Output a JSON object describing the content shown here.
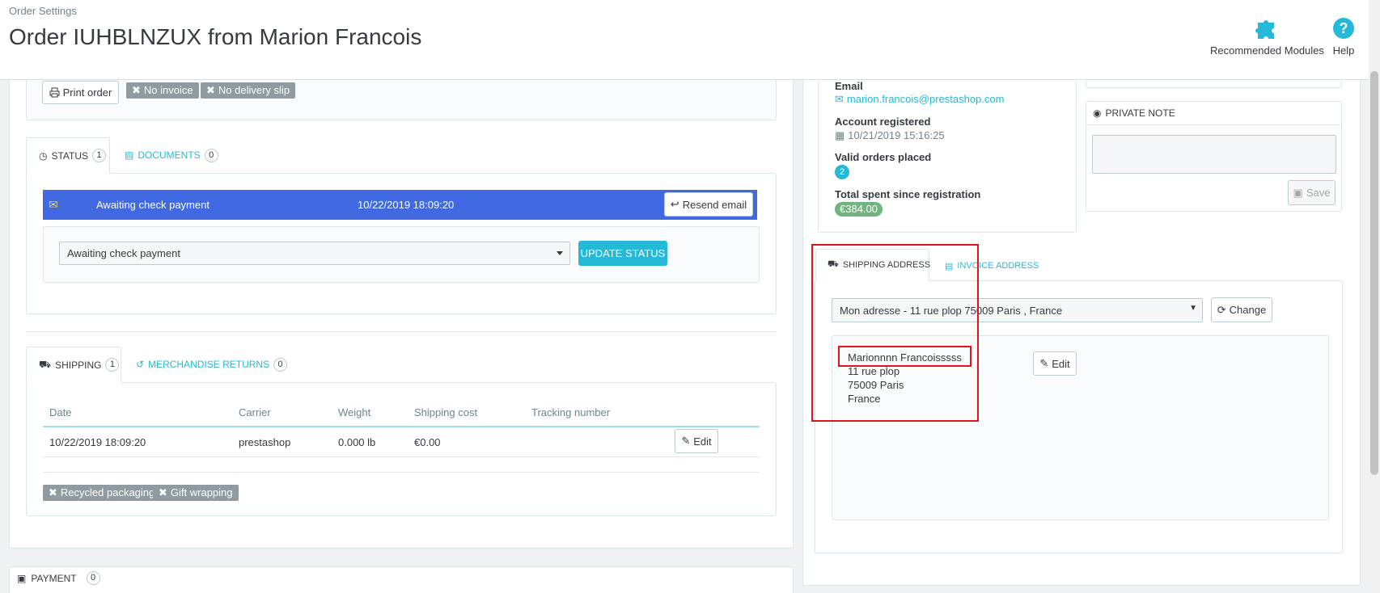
{
  "header": {
    "breadcrumb": "Order Settings",
    "title": "Order IUHBLNZUX from Marion Francois",
    "tools": [
      {
        "label": "Recommended Modules",
        "icon": "puzzle-icon"
      },
      {
        "label": "Help",
        "icon": "help-icon"
      }
    ]
  },
  "order_actions": {
    "print_label": "Print order",
    "no_invoice": "No invoice",
    "no_delivery_slip": "No delivery slip"
  },
  "status_panel": {
    "tabs": [
      {
        "label": "STATUS",
        "count": "1"
      },
      {
        "label": "DOCUMENTS",
        "count": "0"
      }
    ],
    "current": {
      "status": "Awaiting check payment",
      "date": "10/22/2019 18:09:20",
      "resend_label": "Resend email",
      "color": "#4169e1"
    },
    "select_value": "Awaiting check payment",
    "update_label": "UPDATE STATUS"
  },
  "shipping_panel": {
    "tabs": [
      {
        "label": "SHIPPING",
        "count": "1"
      },
      {
        "label": "MERCHANDISE RETURNS",
        "count": "0"
      }
    ],
    "columns": [
      "Date",
      "Carrier",
      "Weight",
      "Shipping cost",
      "Tracking number"
    ],
    "rows": [
      {
        "date": "10/22/2019 18:09:20",
        "carrier": "prestashop",
        "weight": "0.000 lb",
        "cost": "€0.00",
        "tracking": "",
        "edit_label": "Edit"
      }
    ],
    "tags": [
      "Recycled packaging",
      "Gift wrapping"
    ]
  },
  "payment": {
    "label": "PAYMENT",
    "count": "0"
  },
  "customer": {
    "email_label": "Email",
    "email": "marion.francois@prestashop.com",
    "registered_label": "Account registered",
    "registered": "10/21/2019 15:16:25",
    "orders_label": "Valid orders placed",
    "orders": "2",
    "spent_label": "Total spent since registration",
    "spent": "€384.00"
  },
  "private_note": {
    "title": "PRIVATE NOTE",
    "save_label": "Save"
  },
  "address_panel": {
    "tabs": [
      "SHIPPING ADDRESS",
      "INVOICE ADDRESS"
    ],
    "select_value": "Mon adresse - 11 rue plop 75009 Paris , France",
    "change_label": "Change",
    "edit_label": "Edit",
    "lines": [
      "Marionnnn Francoisssss",
      "11 rue plop",
      "75009 Paris",
      "France"
    ]
  },
  "colors": {
    "accent": "#25b9d7",
    "status_bg": "#4169e1",
    "success": "#70b580",
    "highlight": "#e0141e"
  }
}
